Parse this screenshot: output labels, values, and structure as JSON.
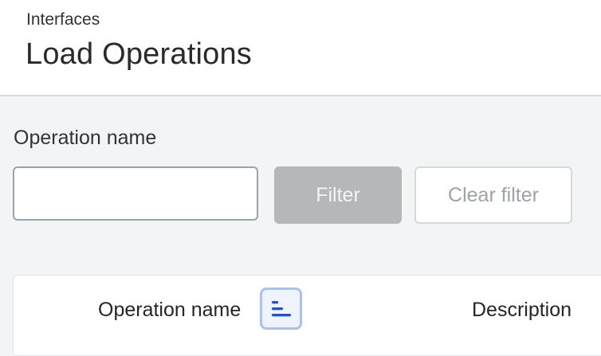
{
  "header": {
    "breadcrumb": "Interfaces",
    "title": "Load Operations"
  },
  "filter": {
    "label": "Operation name",
    "input_value": "",
    "filter_button": "Filter",
    "clear_button": "Clear filter"
  },
  "table": {
    "columns": [
      {
        "label": "Operation name",
        "sort_icon": "sort-ascending-icon"
      },
      {
        "label": "Description"
      }
    ]
  },
  "colors": {
    "header_bg": "#ffffff",
    "page_bg": "#f3f4f6",
    "filter_button_bg": "#b6b7ba",
    "sort_icon": "#2650c8",
    "sort_focus_ring": "#a9c2f2"
  }
}
